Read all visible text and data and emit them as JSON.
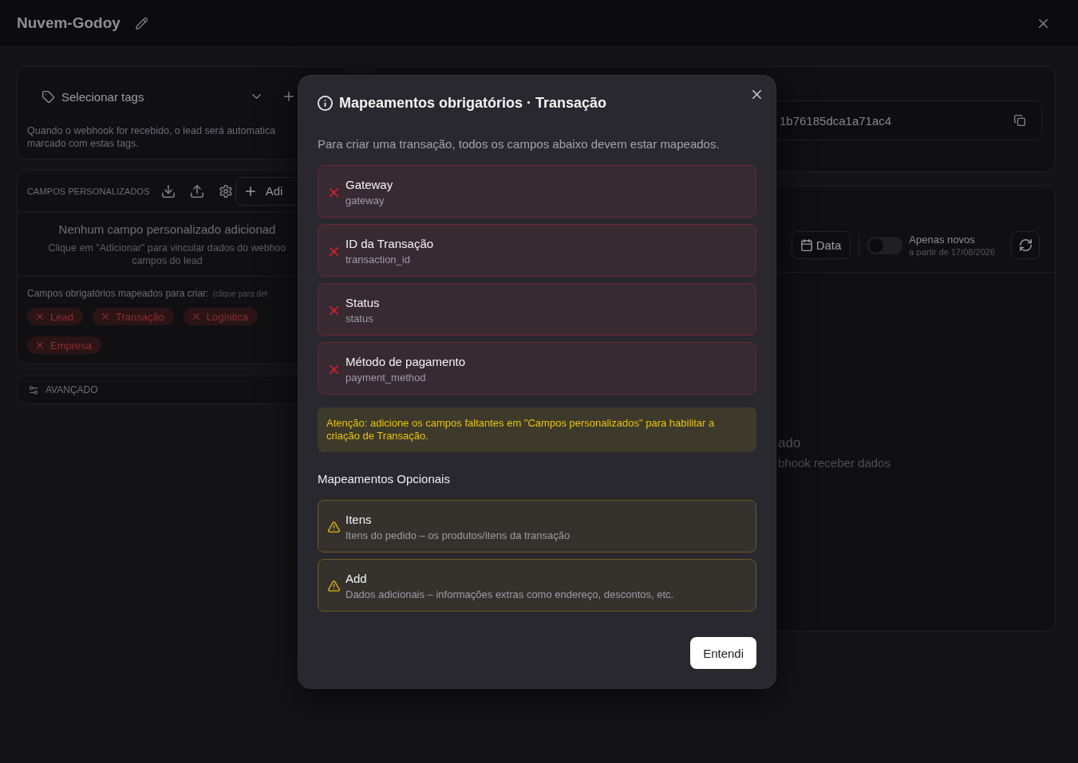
{
  "header": {
    "title": "Nuvem-Godoy"
  },
  "tags": {
    "label": "Selecionar tags",
    "description_lines": [
      "Quando o webhook for recebido, o lead será automatica",
      "marcado com estas tags."
    ]
  },
  "custom_fields": {
    "title": "CAMPOS PERSONALIZADOS",
    "add_button": "Adi",
    "empty_title": "Nenhum campo personalizado adicionad",
    "empty_lines": [
      "Clique em \"Adicionar\" para vincular dados do webhoo",
      "campos do lead"
    ],
    "required_label": "Campos obrigatórios mapeados para criar:",
    "required_hint": "(clique para det",
    "chips": [
      {
        "label": "Lead",
        "mapped": false
      },
      {
        "label": "Transação",
        "mapped": false
      },
      {
        "label": "Logística",
        "mapped": false
      },
      {
        "label": "Empresa",
        "mapped": false
      }
    ]
  },
  "advanced": {
    "label": "AVANÇADO"
  },
  "webhook": {
    "url_value": "1b76185dca1a71ac4"
  },
  "events": {
    "date_button": "Data",
    "new_only": {
      "on": false,
      "label": "Apenas novos",
      "hint": "a partir de 17/08/2026"
    },
    "empty_title": "ado",
    "empty_text": "bhook receber dados"
  },
  "modal": {
    "title": "Mapeamentos obrigatórios · Transação",
    "intro": "Para criar uma transação, todos os campos abaixo devem estar mapeados.",
    "required": [
      {
        "name": "Gateway",
        "key": "gateway",
        "mapped": false
      },
      {
        "name": "ID da Transação",
        "key": "transaction_id",
        "mapped": false
      },
      {
        "name": "Status",
        "key": "status",
        "mapped": false
      },
      {
        "name": "Método de pagamento",
        "key": "payment_method",
        "mapped": false
      }
    ],
    "warning": "Atenção: adicione os campos faltantes em \"Campos personalizados\" para habilitar a criação de Transação.",
    "optional_title": "Mapeamentos Opcionais",
    "optional": [
      {
        "name": "Itens",
        "description": "Itens do pedido – os produtos/itens da transação",
        "mapped": false
      },
      {
        "name": "Add",
        "description": "Dados adicionais – informações extras como endereço, descontos, etc.",
        "mapped": false
      }
    ],
    "confirm_button": "Entendi"
  }
}
